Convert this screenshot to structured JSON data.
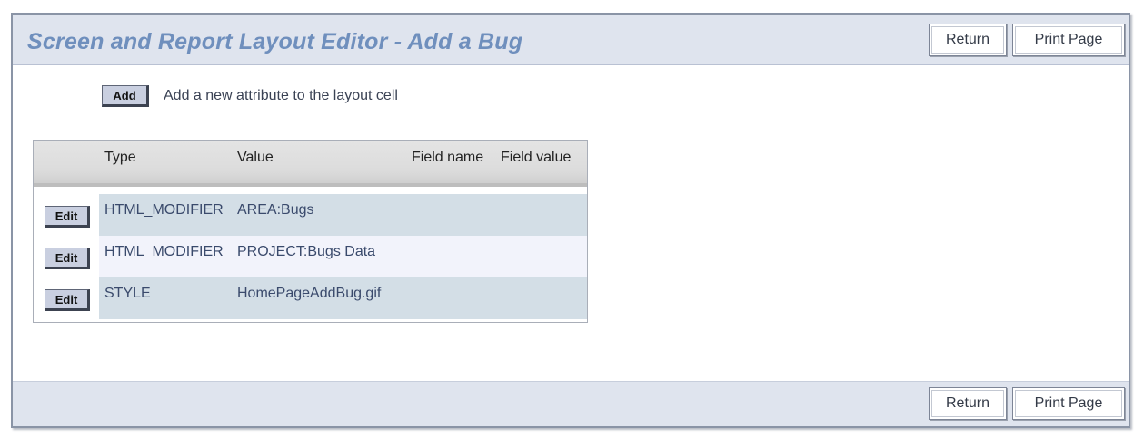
{
  "header": {
    "title": "Screen and Report Layout Editor - Add a Bug",
    "return_label": "Return",
    "print_label": "Print Page"
  },
  "add_section": {
    "button_label": "Add",
    "description": "Add a new attribute to the layout cell"
  },
  "table": {
    "columns": {
      "type": "Type",
      "value": "Value",
      "field_name": "Field name",
      "field_value": "Field value"
    },
    "rows": [
      {
        "edit_label": "Edit",
        "type": "HTML_MODIFIER",
        "value": "AREA:Bugs",
        "field_name": "",
        "field_value": ""
      },
      {
        "edit_label": "Edit",
        "type": "HTML_MODIFIER",
        "value": "PROJECT:Bugs Data",
        "field_name": "",
        "field_value": ""
      },
      {
        "edit_label": "Edit",
        "type": "STYLE",
        "value": "HomePageAddBug.gif",
        "field_name": "",
        "field_value": ""
      }
    ]
  },
  "footer": {
    "return_label": "Return",
    "print_label": "Print Page"
  },
  "colors": {
    "title": "#6f8fbd",
    "header_bg": "#dfe4ee",
    "row_alt": "#d3dee6",
    "row_light": "#f2f3fb"
  }
}
